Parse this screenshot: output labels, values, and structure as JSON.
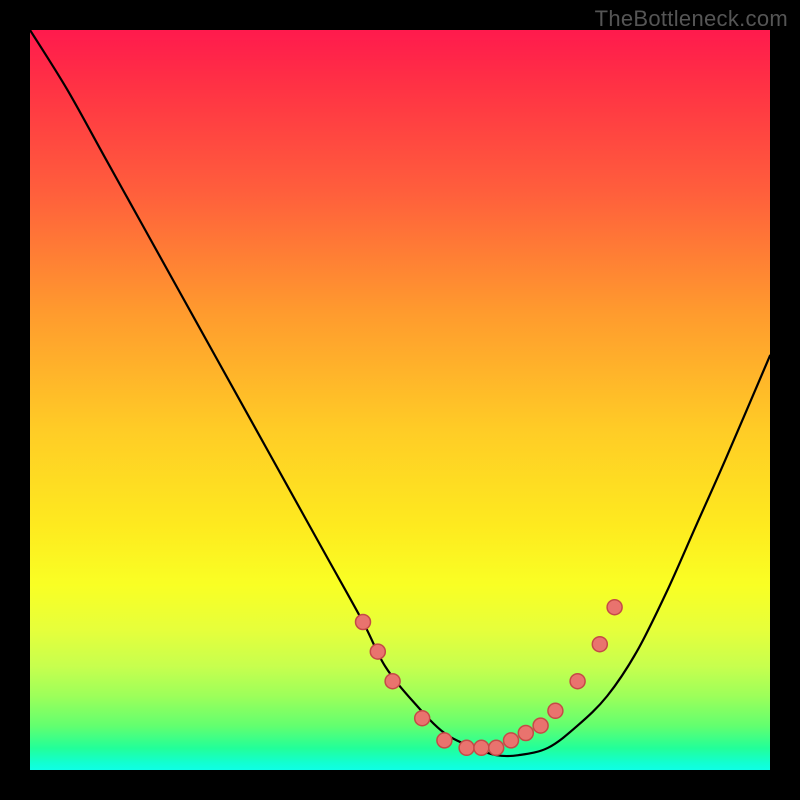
{
  "watermark": "TheBottleneck.com",
  "colors": {
    "frame_bg": "#000000",
    "curve_stroke": "#000000",
    "dot_fill": "#e9736e",
    "dot_stroke": "#c54a47"
  },
  "chart_data": {
    "type": "line",
    "title": "",
    "xlabel": "",
    "ylabel": "",
    "xlim": [
      0,
      100
    ],
    "ylim": [
      0,
      100
    ],
    "grid": false,
    "legend": false,
    "series": [
      {
        "name": "curve",
        "x": [
          0,
          5,
          10,
          15,
          20,
          25,
          30,
          35,
          40,
          45,
          48,
          52,
          56,
          60,
          63,
          66,
          70,
          74,
          78,
          82,
          86,
          90,
          94,
          100
        ],
        "y": [
          100,
          92,
          83,
          74,
          65,
          56,
          47,
          38,
          29,
          20,
          14,
          9,
          5,
          3,
          2,
          2,
          3,
          6,
          10,
          16,
          24,
          33,
          42,
          56
        ]
      }
    ],
    "dots": {
      "name": "markers",
      "x": [
        45,
        47,
        49,
        53,
        56,
        59,
        61,
        63,
        65,
        67,
        69,
        71,
        74,
        77,
        79
      ],
      "y": [
        20,
        16,
        12,
        7,
        4,
        3,
        3,
        3,
        4,
        5,
        6,
        8,
        12,
        17,
        22
      ]
    }
  }
}
